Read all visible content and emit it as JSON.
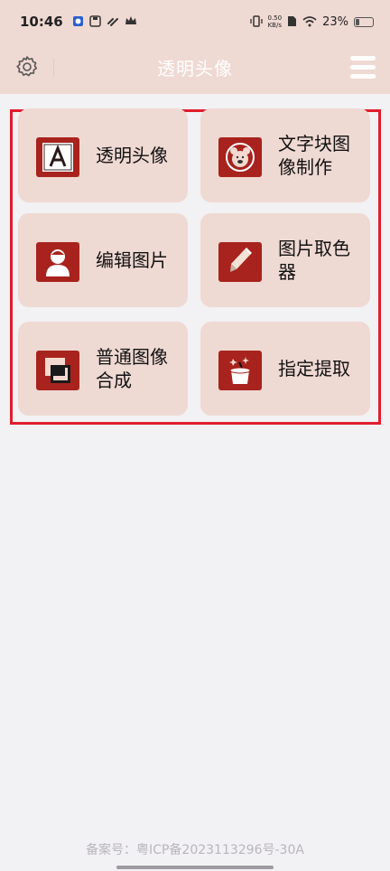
{
  "status_bar": {
    "time": "10:46",
    "net_speed_value": "0.50",
    "net_speed_unit": "KB/s",
    "battery_percent": "23%",
    "battery_level": 0.23
  },
  "header": {
    "title": "透明头像"
  },
  "menu": {
    "items": [
      {
        "label": "透明头像",
        "icon": "letter-a-icon"
      },
      {
        "label": "文字块图像制作",
        "icon": "bear-face-icon"
      },
      {
        "label": "编辑图片",
        "icon": "person-avatar-icon"
      },
      {
        "label": "图片取色器",
        "icon": "pen-icon"
      },
      {
        "label": "普通图像合成",
        "icon": "layers-icon"
      },
      {
        "label": "指定提取",
        "icon": "magic-hat-icon"
      }
    ]
  },
  "footer": {
    "text": "备案号：粤ICP备2023113296号-30A"
  },
  "colors": {
    "accent": "#a8231d",
    "card": "#efd9d3",
    "highlight_border": "#e11d2c"
  }
}
